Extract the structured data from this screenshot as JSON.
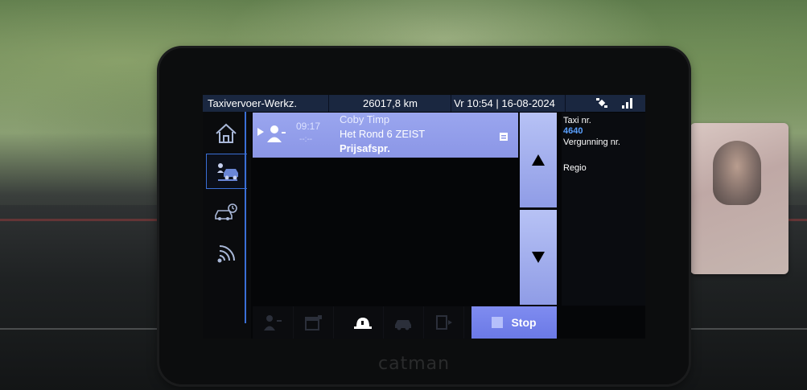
{
  "statusbar": {
    "company": "Taxivervoer-Werkz.",
    "km": "26017,8 km",
    "datetime": "Vr 10:54 | 16-08-2024",
    "icons": [
      "satellite-icon",
      "signal-icon"
    ]
  },
  "sidebar": {
    "items": [
      {
        "icon": "home-icon",
        "active": false
      },
      {
        "icon": "taxi-passenger-icon",
        "active": true
      },
      {
        "icon": "taxi-clock-icon",
        "active": false
      },
      {
        "icon": "wireless-icon",
        "active": false
      }
    ]
  },
  "rides": [
    {
      "time": "09:17",
      "subtime": "--:--",
      "name": "Coby Timp",
      "address": "Het Rond 6 ZEIST",
      "note": "Prijsafspr."
    }
  ],
  "info": {
    "taxi_label": "Taxi nr.",
    "taxi_value": "4640",
    "license_label": "Vergunning nr.",
    "region_label": "Regio"
  },
  "toolbar": {
    "stop_label": "Stop"
  },
  "device": {
    "brand": "catman"
  },
  "colors": {
    "accent": "#3a6fd6",
    "row_bg": "#9aa6ef",
    "status_bg": "#1a2740",
    "value_blue": "#5aa0ff"
  }
}
